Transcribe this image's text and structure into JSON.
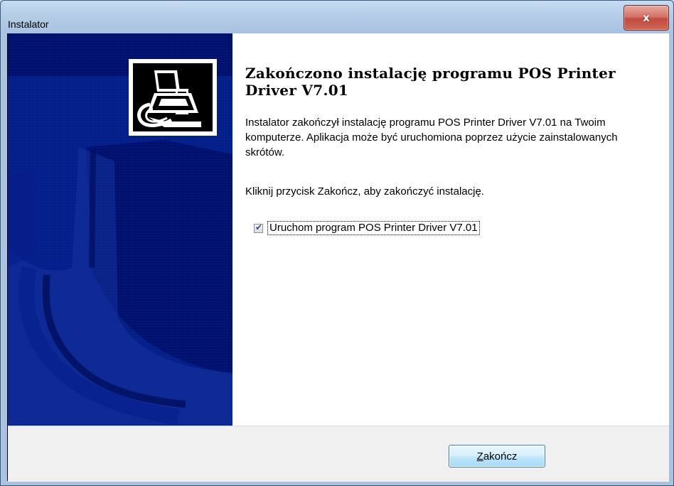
{
  "window": {
    "title": "Instalator",
    "close_glyph": "x"
  },
  "icons": {
    "close": "close-icon",
    "check": "check-icon",
    "installer_logo": "printer-installer-icon"
  },
  "colors": {
    "side_panel": "#00106a",
    "content_bg": "#ffffff",
    "footer_bg": "#f0f0f0",
    "button_border": "#3c7fb1",
    "close_button": "#c24a3f"
  },
  "content": {
    "heading": "Zakończono instalację programu POS Printer Driver V7.01",
    "paragraph1": "Instalator zakończył instalację programu POS Printer Driver V7.01 na Twoim komputerze. Aplikacja może być uruchomiona poprzez użycie zainstalowanych skrótów.",
    "paragraph2": "Kliknij przycisk Zakończ, aby zakończyć instalację.",
    "checkbox": {
      "label": "Uruchom program POS Printer Driver V7.01",
      "checked": true
    }
  },
  "footer": {
    "finish_button": {
      "accel": "Z",
      "rest": "akończ"
    }
  }
}
